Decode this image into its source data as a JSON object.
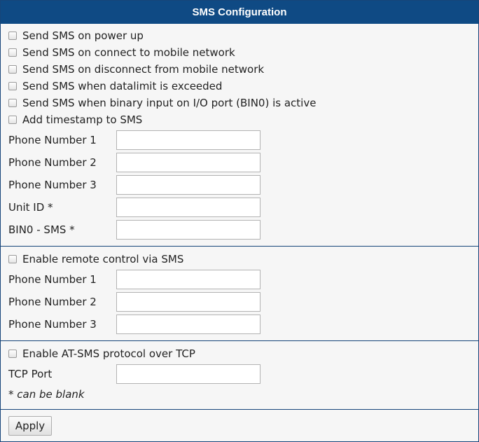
{
  "header": {
    "title": "SMS Configuration"
  },
  "send_section": {
    "checkboxes": [
      {
        "label": "Send SMS on power up",
        "checked": false
      },
      {
        "label": "Send SMS on connect to mobile network",
        "checked": false
      },
      {
        "label": "Send SMS on disconnect from mobile network",
        "checked": false
      },
      {
        "label": "Send SMS when datalimit is exceeded",
        "checked": false
      },
      {
        "label": "Send SMS when binary input on I/O port (BIN0) is active",
        "checked": false
      },
      {
        "label": "Add timestamp to SMS",
        "checked": false
      }
    ],
    "fields": [
      {
        "label": "Phone Number 1",
        "value": ""
      },
      {
        "label": "Phone Number 2",
        "value": ""
      },
      {
        "label": "Phone Number 3",
        "value": ""
      },
      {
        "label": "Unit ID *",
        "value": ""
      },
      {
        "label": "BIN0 - SMS *",
        "value": ""
      }
    ]
  },
  "remote_section": {
    "checkbox": {
      "label": "Enable remote control via SMS",
      "checked": false
    },
    "fields": [
      {
        "label": "Phone Number 1",
        "value": ""
      },
      {
        "label": "Phone Number 2",
        "value": ""
      },
      {
        "label": "Phone Number 3",
        "value": ""
      }
    ]
  },
  "tcp_section": {
    "checkbox": {
      "label": "Enable AT-SMS protocol over TCP",
      "checked": false
    },
    "field": {
      "label": "TCP Port",
      "value": ""
    },
    "note": "* can be blank"
  },
  "footer": {
    "apply_label": "Apply"
  }
}
